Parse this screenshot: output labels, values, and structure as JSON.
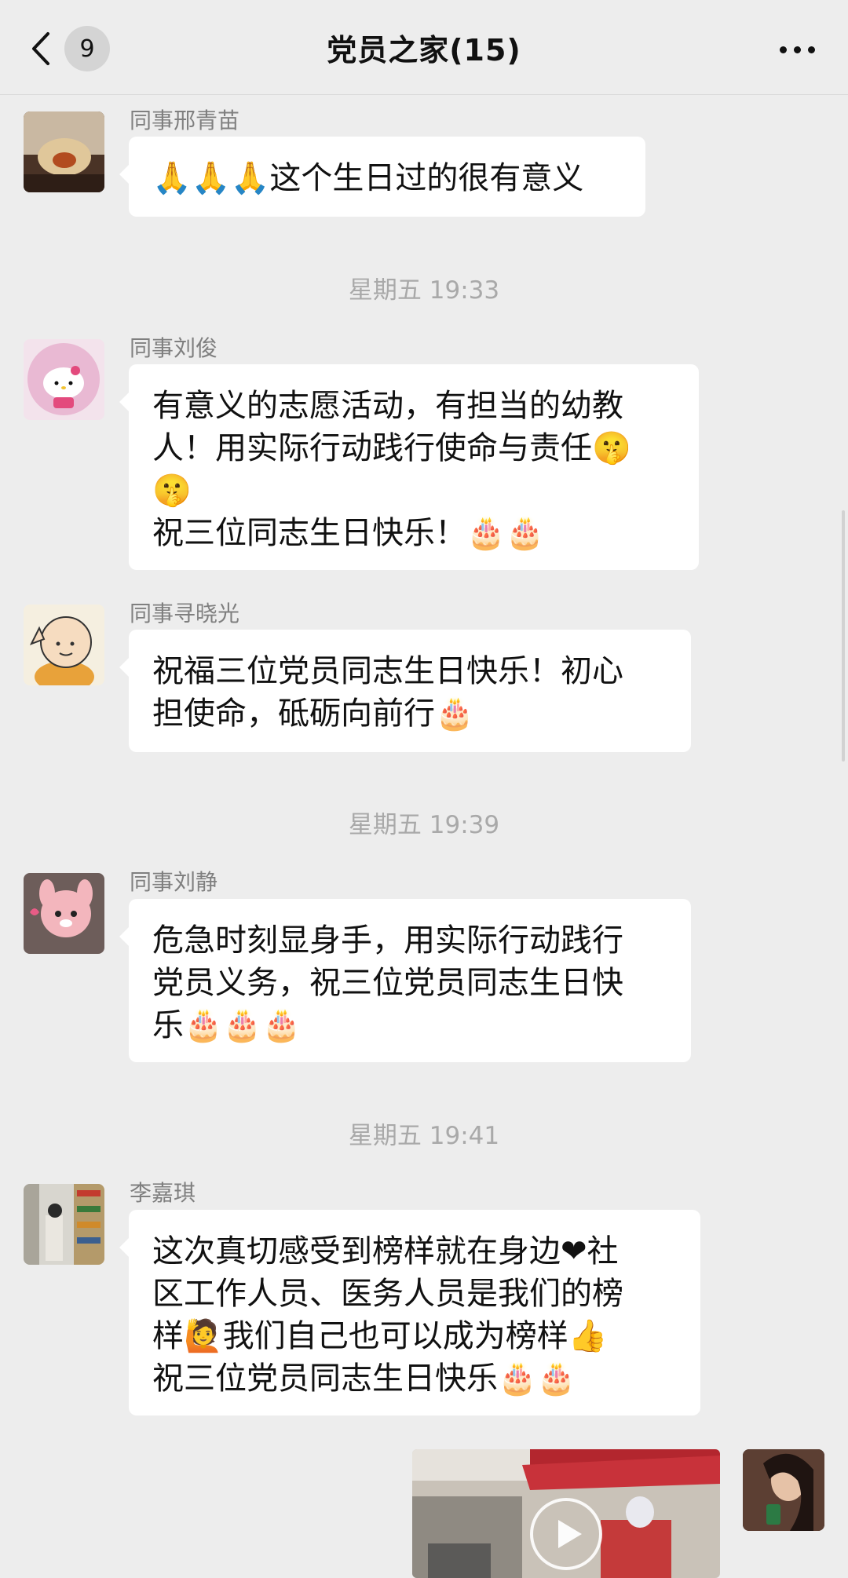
{
  "header": {
    "back_label": "返回",
    "unread_count": "9",
    "title": "党员之家(15)"
  },
  "messages": [
    {
      "sender": "同事邢青苗",
      "text": "🙏🙏🙏这个生日过的很有意义"
    },
    {
      "sender": "同事刘俊",
      "text": "有意义的志愿活动，有担当的幼教\n人！用实际行动践行使命与责任🤫\n🤫\n祝三位同志生日快乐！🎂🎂"
    },
    {
      "sender": "同事寻晓光",
      "text": "祝福三位党员同志生日快乐！初心\n担使命，砥砺向前行🎂"
    },
    {
      "sender": "同事刘静",
      "text": "危急时刻显身手，用实际行动践行\n党员义务，祝三位党员同志生日快\n乐🎂🎂🎂"
    },
    {
      "sender": "李嘉琪",
      "text": "这次真切感受到榜样就在身边❤社\n区工作人员、医务人员是我们的榜\n样🙋我们自己也可以成为榜样👍\n祝三位党员同志生日快乐🎂🎂"
    }
  ],
  "timestamps": [
    "星期五 19:33",
    "星期五 19:39",
    "星期五 19:41"
  ],
  "icons": {
    "back": "chevron-left-icon",
    "more": "more-dots-icon",
    "play": "play-icon"
  },
  "colors": {
    "background": "#ededed",
    "bubble": "#ffffff",
    "sender": "#7f7f7f",
    "timestamp": "#a9a9a9"
  }
}
